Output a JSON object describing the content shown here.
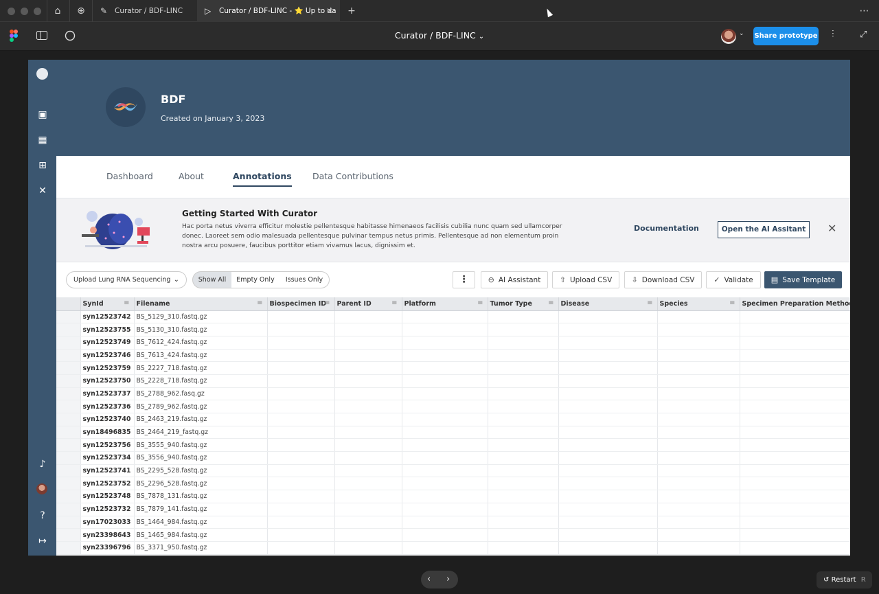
{
  "browser": {
    "tabs": [
      {
        "label": "Curator / BDF-LINC"
      },
      {
        "label": "Curator / BDF-LINC - ⭐ Up to da"
      }
    ],
    "new_tab": "+",
    "menu": "⋯"
  },
  "figma": {
    "file_title": "Curator / BDF-LINC",
    "share_label": "Share prototype"
  },
  "org": {
    "name": "BDF",
    "created": "Created on January 3, 2023"
  },
  "page_tabs": [
    "Dashboard",
    "About",
    "Annotations",
    "Data Contributions"
  ],
  "banner": {
    "title": "Getting Started With Curator",
    "body": "Hac porta netus viverra efficitur molestie pellentesque habitasse himenaeos facilisis cubilia nunc quam sed ullamcorper donec. Laoreet sem odio malesuada pellentesque pulvinar tempus netus primis. Pellentesque ad non elementum proin nostra arcu posuere, faucibus porttitor etiam vivamus lacus, dignissim et.",
    "doc_link": "Documentation",
    "ai_button": "Open the AI Assitant"
  },
  "actions": {
    "upload_select": "Upload Lung RNA Sequencing",
    "filters": [
      "Show All",
      "Empty Only",
      "Issues Only"
    ],
    "ai": "AI Assistant",
    "upload_csv": "Upload CSV",
    "download_csv": "Download CSV",
    "validate": "Validate",
    "save_template": "Save Template"
  },
  "table": {
    "columns": [
      "SynId",
      "Filename",
      "Biospecimen ID",
      "Parent ID",
      "Platform",
      "Tumor Type",
      "Disease",
      "Species",
      "Specimen Preparation Method"
    ],
    "rows": [
      [
        "syn12523742",
        "BS_5129_310.fastq.gz"
      ],
      [
        "syn12523755",
        "BS_5130_310.fastq.gz"
      ],
      [
        "syn12523749",
        "BS_7612_424.fastq.gz"
      ],
      [
        "syn12523746",
        "BS_7613_424.fastq.gz"
      ],
      [
        "syn12523759",
        "BS_2227_718.fastq.gz"
      ],
      [
        "syn12523750",
        "BS_2228_718.fastq.gz"
      ],
      [
        "syn12523737",
        "BS_2788_962.fasq.gz"
      ],
      [
        "syn12523736",
        "BS_2789_962.fastq.gz"
      ],
      [
        "syn12523740",
        "BS_2463_219.fastq.gz"
      ],
      [
        "syn18496835",
        "BS_2464_219_fastq.gz"
      ],
      [
        "syn12523756",
        "BS_3555_940.fastq.gz"
      ],
      [
        "syn12523734",
        "BS_3556_940.fastq.gz"
      ],
      [
        "syn12523741",
        "BS_2295_528.fastq.gz"
      ],
      [
        "syn12523752",
        "BS_2296_528.fastq.gz"
      ],
      [
        "syn12523748",
        "BS_7878_131.fastq.gz"
      ],
      [
        "syn12523732",
        "BS_7879_141.fastq.gz"
      ],
      [
        "syn17023033",
        "BS_1464_984.fastq.gz"
      ],
      [
        "syn23398643",
        "BS_1465_984.fastq.gz"
      ],
      [
        "syn23396796",
        "BS_3371_950.fastq.gz"
      ]
    ]
  },
  "bottom": {
    "prev": "‹",
    "next": "›",
    "restart": "Restart",
    "restart_key": "R"
  }
}
